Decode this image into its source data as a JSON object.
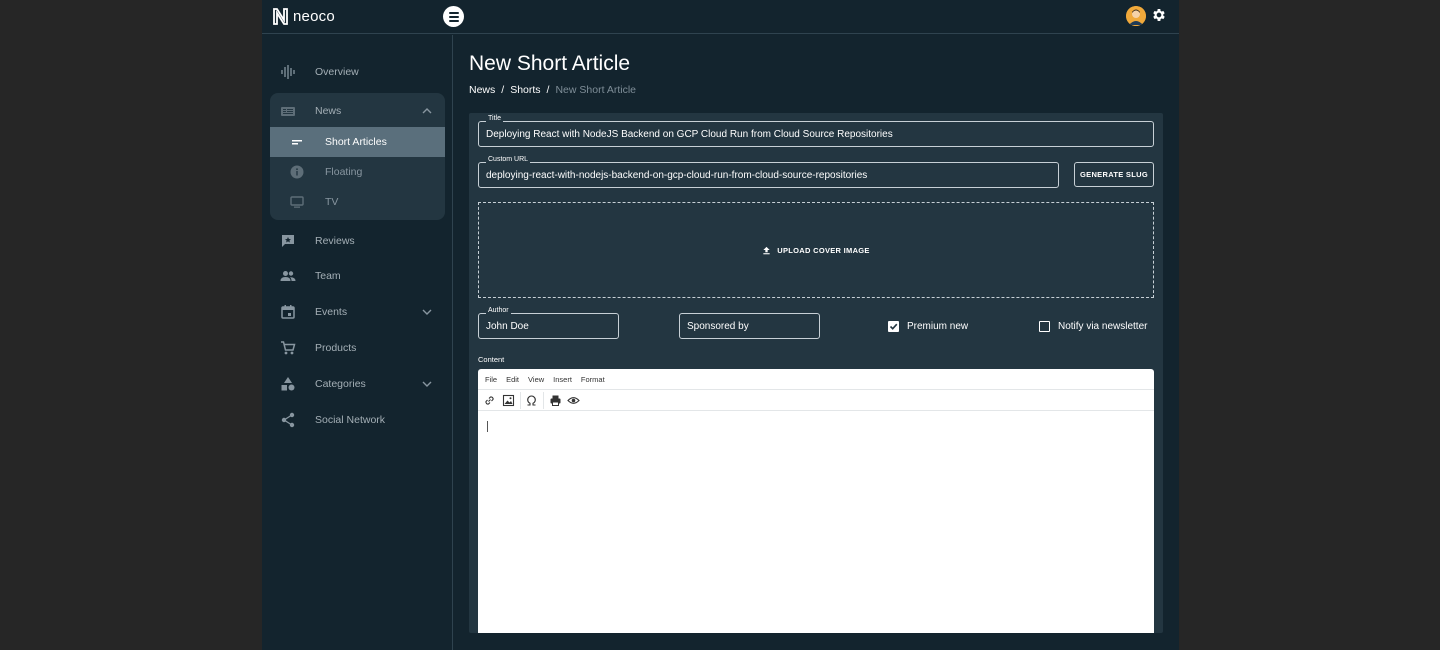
{
  "brand": {
    "name": "neoco"
  },
  "sidebar": {
    "items": [
      {
        "label": "Overview",
        "icon": "waveform-icon"
      },
      {
        "label": "News",
        "icon": "newspaper-icon",
        "expanded": true,
        "children": [
          {
            "label": "Short Articles",
            "icon": "short-text-icon",
            "active": true
          },
          {
            "label": "Floating",
            "icon": "info-icon"
          },
          {
            "label": "TV",
            "icon": "tv-icon"
          }
        ]
      },
      {
        "label": "Reviews",
        "icon": "rate-review-icon"
      },
      {
        "label": "Team",
        "icon": "people-icon"
      },
      {
        "label": "Events",
        "icon": "calendar-icon",
        "expandable": true
      },
      {
        "label": "Products",
        "icon": "cart-icon"
      },
      {
        "label": "Categories",
        "icon": "category-icon",
        "expandable": true
      },
      {
        "label": "Social Network",
        "icon": "share-icon"
      }
    ]
  },
  "page": {
    "title": "New Short Article",
    "breadcrumb": [
      "News",
      "Shorts",
      "New Short Article"
    ],
    "breadcrumb_sep": "/"
  },
  "form": {
    "title": {
      "label": "Title",
      "value": "Deploying React with NodeJS Backend on GCP Cloud Run from Cloud Source Repositories"
    },
    "custom_url": {
      "label": "Custom URL",
      "value": "deploying-react-with-nodejs-backend-on-gcp-cloud-run-from-cloud-source-repositories"
    },
    "generate_slug": "GENERATE SLUG",
    "upload_cover": "UPLOAD COVER IMAGE",
    "author": {
      "label": "Author",
      "value": "John Doe"
    },
    "sponsored_by": {
      "placeholder": "Sponsored by"
    },
    "premium": {
      "label": "Premium new",
      "checked": true
    },
    "newsletter": {
      "label": "Notify via newsletter",
      "checked": false
    },
    "content_label": "Content"
  },
  "editor": {
    "menu": [
      "File",
      "Edit",
      "View",
      "Insert",
      "Format"
    ],
    "toolbar": [
      "link-icon",
      "image-icon",
      "omega-icon",
      "print-icon",
      "preview-icon"
    ]
  },
  "colors": {
    "background": "#13242e",
    "card": "#233641",
    "active": "#5a6f7c",
    "accent": "#f0a93b"
  }
}
